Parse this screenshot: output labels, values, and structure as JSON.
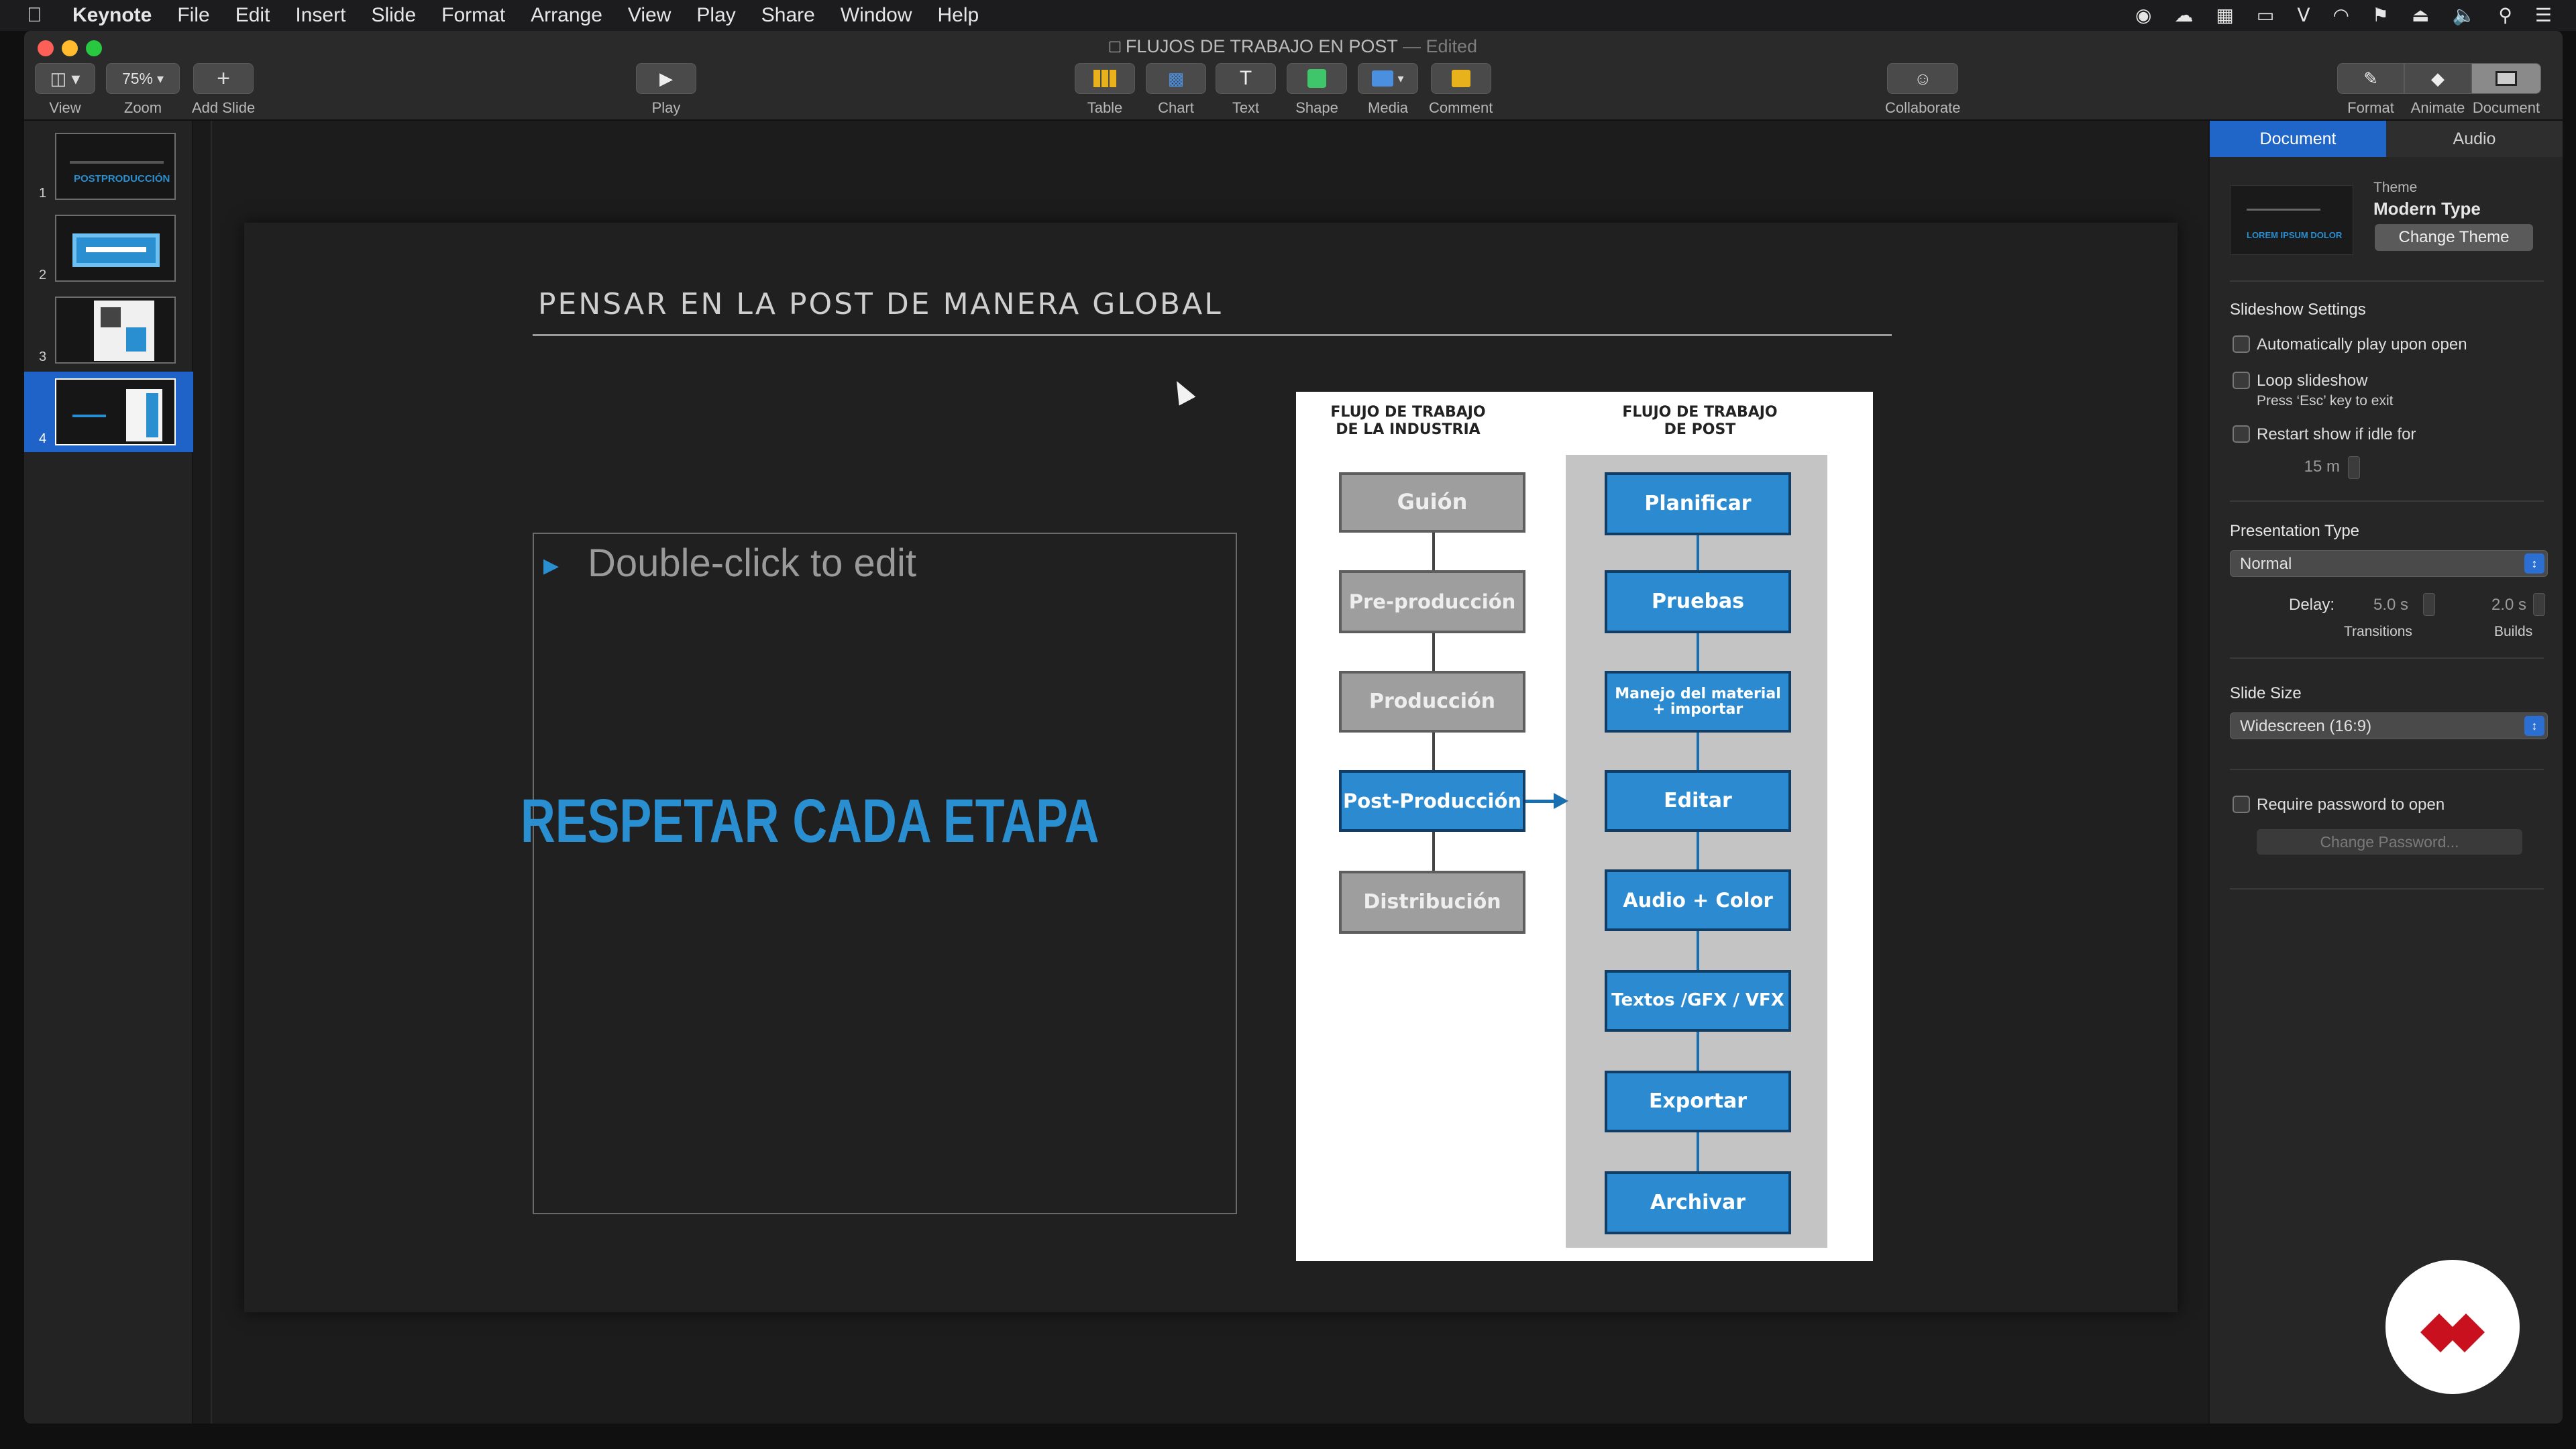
{
  "menubar": {
    "app": "Keynote",
    "items": [
      "File",
      "Edit",
      "Insert",
      "Slide",
      "Format",
      "Arrange",
      "View",
      "Play",
      "Share",
      "Window",
      "Help"
    ],
    "status_icons": [
      "record-icon",
      "creative-cloud-icon",
      "dropbox-icon",
      "airplay-icon",
      "bluetooth-icon",
      "wifi-icon",
      "flag-icon",
      "eject-icon",
      "volume-icon",
      "search-icon",
      "list-icon"
    ]
  },
  "window": {
    "title": "FLUJOS DE TRABAJO EN POST",
    "edited": "— Edited"
  },
  "toolbar": {
    "view": "View",
    "zoom_value": "75%",
    "zoom": "Zoom",
    "add_slide": "Add Slide",
    "play": "Play",
    "table": "Table",
    "chart": "Chart",
    "text": "Text",
    "shape": "Shape",
    "media": "Media",
    "comment": "Comment",
    "collaborate": "Collaborate",
    "format": "Format",
    "animate": "Animate",
    "document": "Document"
  },
  "slides": {
    "numbers": [
      "1",
      "2",
      "3",
      "4"
    ],
    "selected": 4,
    "thumb1_text": "POSTPRODUCCIÓN"
  },
  "slide": {
    "title": "PENSAR EN LA POST DE MANERA GLOBAL",
    "placeholder": "Double-click to edit",
    "overlay_text": "RESPETAR CADA ETAPA",
    "left_header": "FLUJO DE TRABAJO\nDE LA INDUSTRIA",
    "right_header": "FLUJO DE TRABAJO\nDE POST",
    "industry_steps": [
      "Guión",
      "Pre-producción",
      "Producción",
      "Post-Producción",
      "Distribución"
    ],
    "post_steps": [
      "Planificar",
      "Pruebas",
      "Manejo del material + importar",
      "Editar",
      "Audio + Color",
      "Textos /GFX / VFX",
      "Exportar",
      "Archivar"
    ]
  },
  "inspector": {
    "tab_document": "Document",
    "tab_audio": "Audio",
    "theme_label": "Theme",
    "theme_name": "Modern Type",
    "theme_thumb_text": "LOREM IPSUM DOLOR",
    "change_theme": "Change Theme",
    "slideshow_settings": "Slideshow Settings",
    "auto_play": "Automatically play upon open",
    "loop": "Loop slideshow",
    "loop_hint": "Press ‘Esc’ key to exit",
    "restart": "Restart show if idle for",
    "idle_value": "15 m",
    "presentation_type": "Presentation Type",
    "presentation_value": "Normal",
    "delay_label": "Delay:",
    "transitions_value": "5.0 s",
    "builds_value": "2.0 s",
    "transitions": "Transitions",
    "builds": "Builds",
    "slide_size": "Slide Size",
    "slide_size_value": "Widescreen (16:9)",
    "require_password": "Require password to open",
    "change_password": "Change Password..."
  },
  "colors": {
    "accent": "#2066c9",
    "slide_blue": "#2a8fd0",
    "logo_red": "#c8101e"
  }
}
